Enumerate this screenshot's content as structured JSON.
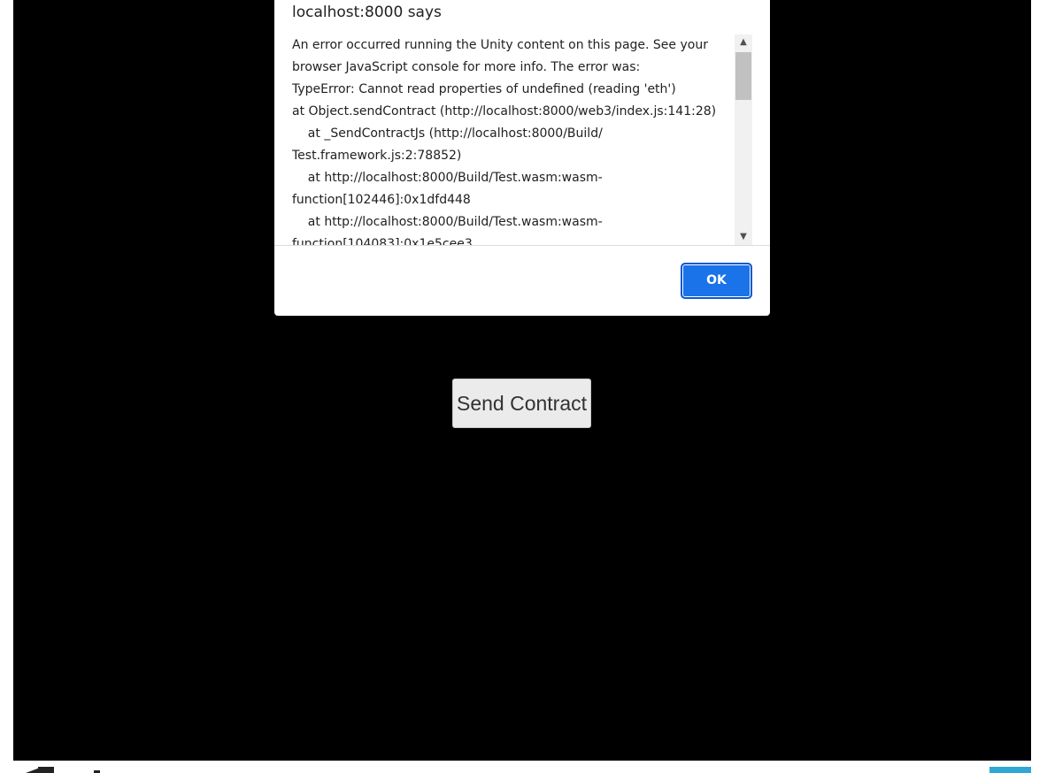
{
  "dialog": {
    "title": "localhost:8000 says",
    "message": "An error occurred running the Unity content on this page. See your\nbrowser JavaScript console for more info. The error was:\nTypeError: Cannot read properties of undefined (reading 'eth')\nat Object.sendContract (http://localhost:8000/web3/index.js:141:28)\n    at _SendContractJs (http://localhost:8000/Build/\nTest.framework.js:2:78852)\n    at http://localhost:8000/Build/Test.wasm:wasm-\nfunction[102446]:0x1dfd448\n    at http://localhost:8000/Build/Test.wasm:wasm-\nfunction[104083]:0x1e5cee3",
    "ok_label": "OK"
  },
  "game": {
    "send_contract_label": "Send Contract"
  },
  "icons": {
    "scroll_up": "chevron-up-icon",
    "scroll_down": "chevron-down-icon",
    "footer_logo": "unity-logo-icon",
    "fullscreen": "fullscreen-icon"
  },
  "colors": {
    "canvas_background": "#000000",
    "ok_button": "#1a73e8",
    "fullscreen_button": "#2fa8d3"
  }
}
